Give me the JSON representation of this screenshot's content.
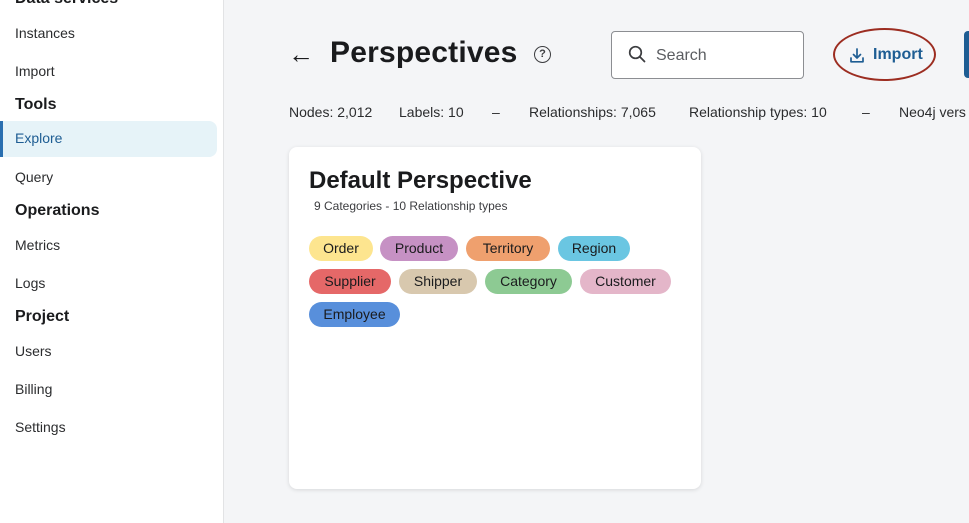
{
  "sidebar": {
    "section_top": "Data services",
    "items_data": [
      "Instances",
      "Import"
    ],
    "heading_tools": "Tools",
    "item_explore": "Explore",
    "item_query": "Query",
    "heading_operations": "Operations",
    "items_operations": [
      "Metrics",
      "Logs"
    ],
    "heading_project": "Project",
    "items_project": [
      "Users",
      "Billing",
      "Settings"
    ]
  },
  "header": {
    "back": "←",
    "title": "Perspectives",
    "help": "?",
    "search_placeholder": "Search",
    "import_label": "Import"
  },
  "stats": {
    "nodes": "Nodes: 2,012",
    "labels": "Labels: 10",
    "sep1": "–",
    "relationships": "Relationships: 7,065",
    "relationship_types": "Relationship types: 10",
    "sep2": "–",
    "neo4j_version": "Neo4j vers"
  },
  "card": {
    "title": "Default Perspective",
    "subtitle": "9 Categories - 10 Relationship types",
    "tags": [
      {
        "label": "Order",
        "color": "#fde58f"
      },
      {
        "label": "Product",
        "color": "#c691c4"
      },
      {
        "label": "Territory",
        "color": "#efa06e"
      },
      {
        "label": "Region",
        "color": "#6ac6e2"
      },
      {
        "label": "Supplier",
        "color": "#e56868"
      },
      {
        "label": "Shipper",
        "color": "#d8c8ae"
      },
      {
        "label": "Category",
        "color": "#8dca93"
      },
      {
        "label": "Customer",
        "color": "#e4b6c9"
      },
      {
        "label": "Employee",
        "color": "#588fdb"
      }
    ]
  }
}
